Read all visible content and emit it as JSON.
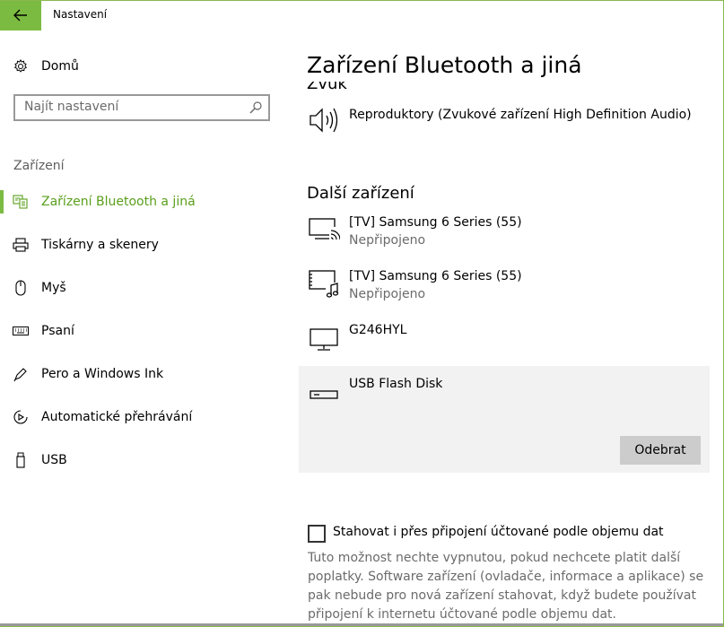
{
  "window": {
    "title": "Nastavení"
  },
  "sidebar": {
    "home_label": "Domů",
    "search_placeholder": "Najít nastavení",
    "section_label": "Zařízení",
    "items": [
      {
        "label": "Zařízení Bluetooth a jiná",
        "icon": "bluetooth-devices-icon",
        "active": true
      },
      {
        "label": "Tiskárny a skenery",
        "icon": "printer-icon",
        "active": false
      },
      {
        "label": "Myš",
        "icon": "mouse-icon",
        "active": false
      },
      {
        "label": "Psaní",
        "icon": "keyboard-icon",
        "active": false
      },
      {
        "label": "Pero a Windows Ink",
        "icon": "pen-icon",
        "active": false
      },
      {
        "label": "Automatické přehrávání",
        "icon": "autoplay-icon",
        "active": false
      },
      {
        "label": "USB",
        "icon": "usb-icon",
        "active": false
      }
    ]
  },
  "main": {
    "title": "Zařízení Bluetooth a jiná",
    "audio_section_partial": "Zvuk",
    "audio_device": {
      "name": "Reproduktory (Zvukové zařízení High Definition Audio)",
      "icon": "speaker-icon"
    },
    "other_section": "Další zařízení",
    "other_devices": [
      {
        "name": "[TV] Samsung 6 Series (55)",
        "status": "Nepřipojeno",
        "icon": "tv-cast-icon"
      },
      {
        "name": "[TV] Samsung 6 Series (55)",
        "status": "Nepřipojeno",
        "icon": "tv-media-icon"
      },
      {
        "name": "G246HYL",
        "status": "",
        "icon": "monitor-icon"
      },
      {
        "name": "USB Flash Disk",
        "status": "",
        "icon": "usb-drive-icon",
        "selected": true
      }
    ],
    "remove_button": "Odebrat",
    "metered_checkbox": {
      "label": "Stahovat i přes připojení účtované podle objemu dat",
      "checked": false
    },
    "metered_description": "Tuto možnost nechte vypnutou, pokud nechcete platit další poplatky. Software zařízení (ovladače, informace a aplikace) se pak nebude pro nová zařízení stahovat, když budete používat připojení k internetu účtované podle objemu dat."
  },
  "colors": {
    "accent": "#7cbb42",
    "accent_text": "#5a9f1c",
    "selected_bg": "#f2f2f2",
    "button_bg": "#cccccc"
  }
}
